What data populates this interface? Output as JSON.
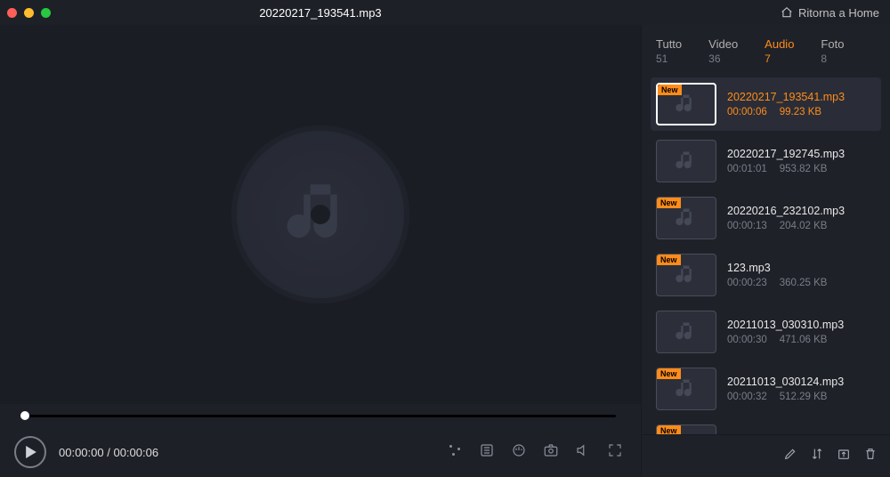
{
  "header": {
    "title": "20220217_193541.mp3",
    "home_label": "Ritorna a Home"
  },
  "player": {
    "current_time": "00:00:00",
    "total_time": "00:00:06"
  },
  "tabs": [
    {
      "label": "Tutto",
      "count": "51"
    },
    {
      "label": "Video",
      "count": "36"
    },
    {
      "label": "Audio",
      "count": "7"
    },
    {
      "label": "Foto",
      "count": "8"
    }
  ],
  "active_tab_index": 2,
  "new_badge_text": "New",
  "files": [
    {
      "name": "20220217_193541.mp3",
      "duration": "00:00:06",
      "size": "99.23 KB",
      "isNew": true,
      "selected": true
    },
    {
      "name": "20220217_192745.mp3",
      "duration": "00:01:01",
      "size": "953.82 KB",
      "isNew": false,
      "selected": false
    },
    {
      "name": "20220216_232102.mp3",
      "duration": "00:00:13",
      "size": "204.02 KB",
      "isNew": true,
      "selected": false
    },
    {
      "name": "123.mp3",
      "duration": "00:00:23",
      "size": "360.25 KB",
      "isNew": true,
      "selected": false
    },
    {
      "name": "20211013_030310.mp3",
      "duration": "00:00:30",
      "size": "471.06 KB",
      "isNew": false,
      "selected": false
    },
    {
      "name": "20211013_030124.mp3",
      "duration": "00:00:32",
      "size": "512.29 KB",
      "isNew": true,
      "selected": false
    },
    {
      "name": "",
      "duration": "",
      "size": "",
      "isNew": true,
      "selected": false
    }
  ]
}
